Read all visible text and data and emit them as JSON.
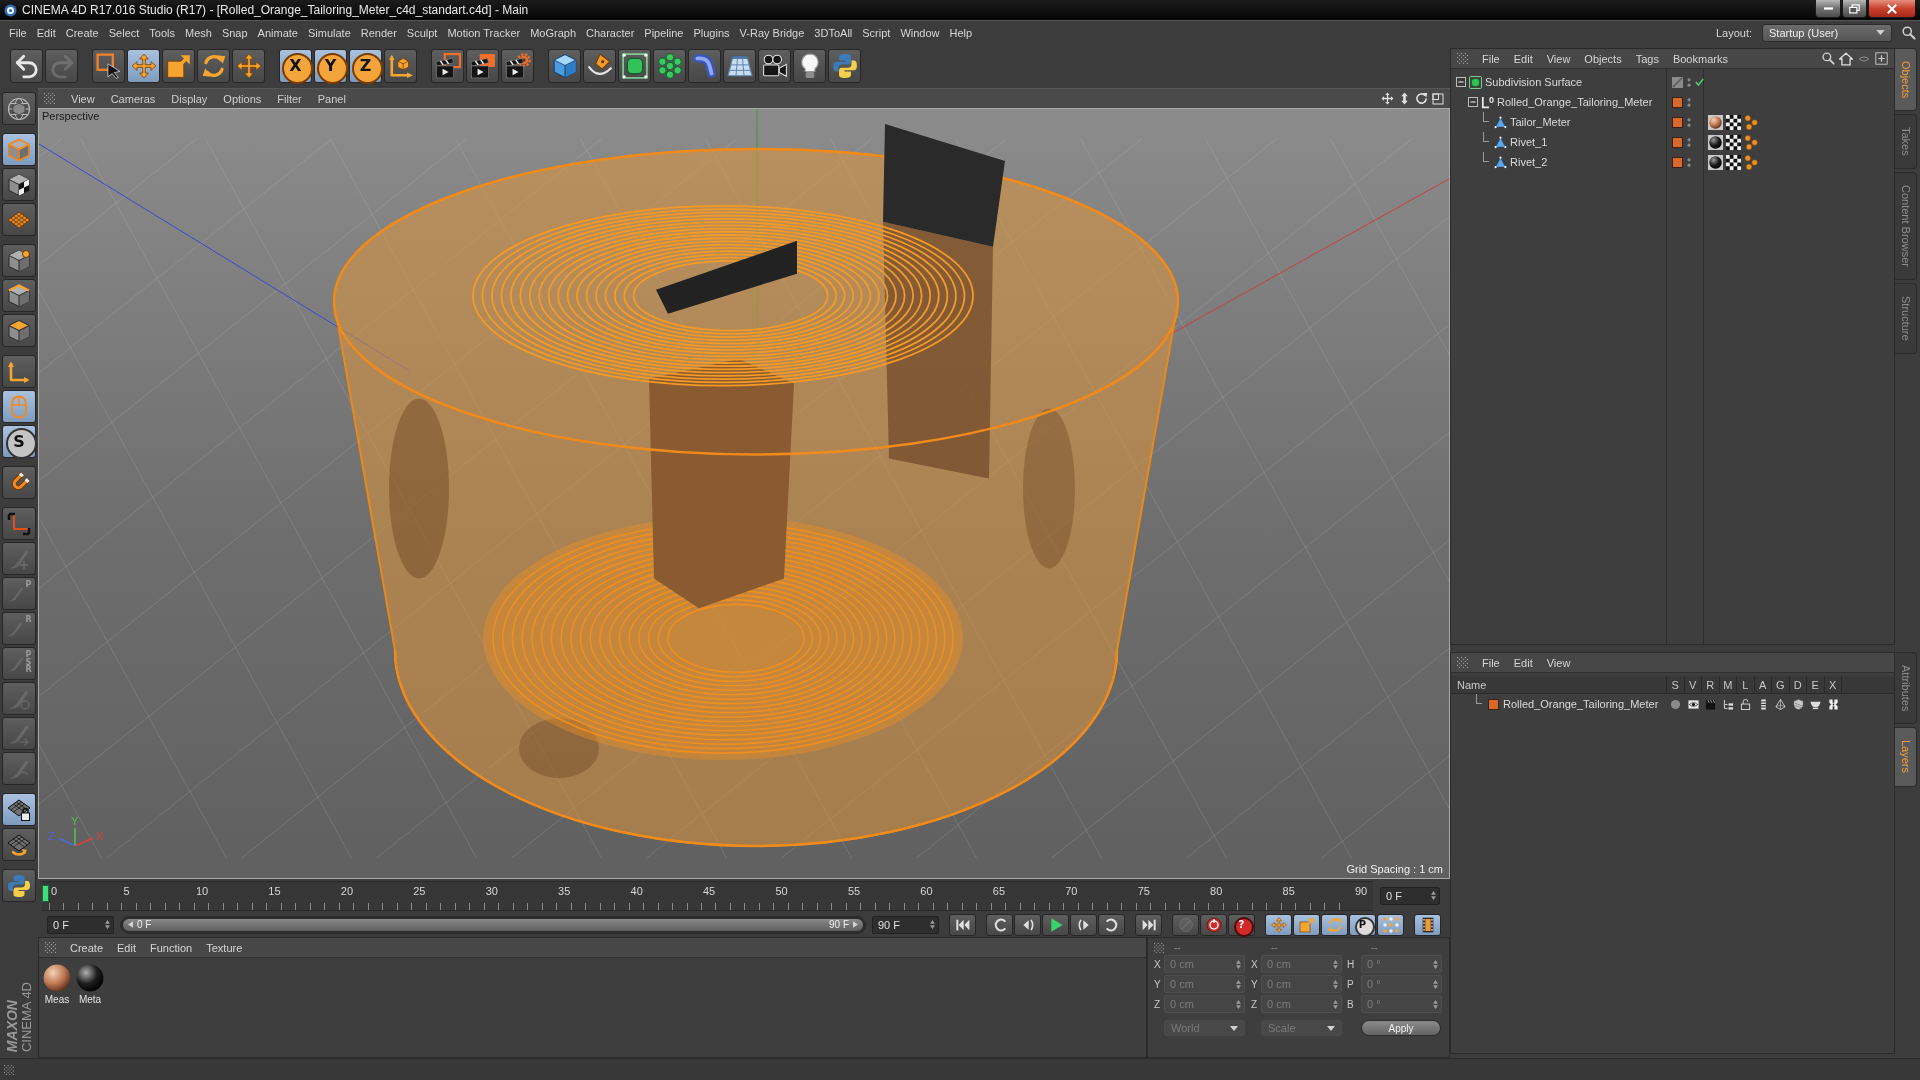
{
  "window": {
    "title": "CINEMA 4D R17.016 Studio (R17) - [Rolled_Orange_Tailoring_Meter_c4d_standart.c4d] - Main"
  },
  "menu_bar": {
    "items": [
      "File",
      "Edit",
      "Create",
      "Select",
      "Tools",
      "Mesh",
      "Snap",
      "Animate",
      "Simulate",
      "Render",
      "Sculpt",
      "Motion Tracker",
      "MoGraph",
      "Character",
      "Pipeline",
      "Plugins",
      "V-Ray Bridge",
      "3DToAll",
      "Script",
      "Window",
      "Help"
    ],
    "layout_label": "Layout:",
    "layout_value": "Startup (User)"
  },
  "toolbar": [
    [
      {
        "kind": "undo",
        "selected": false,
        "disabled": false
      },
      {
        "kind": "redo",
        "selected": false,
        "disabled": true
      }
    ],
    [
      {
        "kind": "live-select",
        "selected": false,
        "disabled": false
      },
      {
        "kind": "move",
        "selected": true,
        "disabled": false
      },
      {
        "kind": "scale",
        "selected": false,
        "disabled": false
      },
      {
        "kind": "rotate",
        "selected": false,
        "disabled": false
      },
      {
        "kind": "move",
        "selected": false,
        "disabled": false
      }
    ],
    [
      {
        "kind": "axis",
        "label": "X",
        "selected": true,
        "disabled": false
      },
      {
        "kind": "axis",
        "label": "Y",
        "selected": true,
        "disabled": false
      },
      {
        "kind": "axis",
        "label": "Z",
        "selected": true,
        "disabled": false
      },
      {
        "kind": "coord-system",
        "selected": false,
        "disabled": false
      }
    ],
    [
      {
        "kind": "render-view",
        "selected": false,
        "disabled": false
      },
      {
        "kind": "render-picture",
        "selected": false,
        "disabled": false
      },
      {
        "kind": "render-settings",
        "selected": false,
        "disabled": false
      }
    ],
    [
      {
        "kind": "cube",
        "selected": false,
        "disabled": false
      },
      {
        "kind": "pen",
        "selected": false,
        "disabled": false
      },
      {
        "kind": "subdivision",
        "selected": false,
        "disabled": false
      },
      {
        "kind": "cloner",
        "selected": false,
        "disabled": false
      },
      {
        "kind": "bend",
        "selected": false,
        "disabled": false
      },
      {
        "kind": "floor",
        "selected": false,
        "disabled": false
      },
      {
        "kind": "camera",
        "selected": false,
        "disabled": false
      },
      {
        "kind": "light",
        "selected": false,
        "disabled": false
      },
      {
        "kind": "python",
        "selected": false,
        "disabled": false
      }
    ]
  ],
  "left_toolbar": [
    [
      {
        "kind": "make-editable",
        "selected": false,
        "disabled": false
      }
    ],
    [
      {
        "kind": "model",
        "selected": true,
        "disabled": false
      },
      {
        "kind": "texture",
        "selected": false,
        "disabled": false
      },
      {
        "kind": "workplane",
        "selected": false,
        "disabled": false
      }
    ],
    [
      {
        "kind": "points",
        "selected": false,
        "disabled": false
      },
      {
        "kind": "edges",
        "selected": false,
        "disabled": false
      },
      {
        "kind": "polygons",
        "selected": false,
        "disabled": false
      }
    ],
    [
      {
        "kind": "axis-mode",
        "selected": false,
        "disabled": false
      },
      {
        "kind": "tweak",
        "selected": true,
        "disabled": false
      },
      {
        "kind": "snap",
        "label": "S",
        "selected": true,
        "disabled": false
      }
    ],
    [
      {
        "kind": "magnet",
        "selected": false,
        "disabled": false
      }
    ],
    [
      {
        "kind": "workplane-axis",
        "selected": false,
        "disabled": false
      },
      {
        "kind": "sculpt-move",
        "selected": false,
        "disabled": true
      },
      {
        "kind": "sculpt",
        "label": "P",
        "selected": false,
        "disabled": true
      },
      {
        "kind": "sculpt",
        "label": "R",
        "selected": false,
        "disabled": true
      },
      {
        "kind": "sculpt",
        "label": "PSR",
        "selected": false,
        "disabled": true
      },
      {
        "kind": "sculpt-circle",
        "selected": false,
        "disabled": true
      },
      {
        "kind": "sculpt-pull",
        "selected": false,
        "disabled": true
      },
      {
        "kind": "sculpt-smooth",
        "selected": false,
        "disabled": true
      }
    ],
    [
      {
        "kind": "grid-lock",
        "selected": true,
        "disabled": false
      },
      {
        "kind": "grid-rotate",
        "selected": false,
        "disabled": false
      }
    ],
    [
      {
        "kind": "python",
        "selected": false,
        "disabled": false
      }
    ]
  ],
  "logo": {
    "brand": "MAXON",
    "product": "CINEMA 4D"
  },
  "viewport": {
    "menu": [
      "View",
      "Cameras",
      "Display",
      "Options",
      "Filter",
      "Panel"
    ],
    "camera": "Perspective",
    "grid_spacing": "Grid Spacing : 1 cm",
    "gizmo": [
      "Z",
      "Y",
      "X"
    ]
  },
  "timeline": {
    "ticks": [
      "0",
      "5",
      "10",
      "15",
      "20",
      "25",
      "30",
      "35",
      "40",
      "45",
      "50",
      "55",
      "60",
      "65",
      "70",
      "75",
      "80",
      "85",
      "90"
    ],
    "playhead": {
      "level": 0
    },
    "frame_field": "0 F"
  },
  "playback": {
    "start_field": "0 F",
    "range": {
      "start": "0 F",
      "end": "90 F",
      "level": 1
    },
    "end_field": "90 F",
    "buttons": [
      [
        {
          "kind": "go-start",
          "selected": false,
          "disabled": false
        }
      ],
      [
        {
          "kind": "prev-key",
          "selected": false,
          "disabled": false
        },
        {
          "kind": "prev-frame",
          "selected": false,
          "disabled": false
        },
        {
          "kind": "play",
          "selected": false,
          "disabled": false
        },
        {
          "kind": "next-frame",
          "selected": false,
          "disabled": false
        },
        {
          "kind": "next-key",
          "selected": false,
          "disabled": false
        }
      ],
      [
        {
          "kind": "go-end",
          "selected": false,
          "disabled": false
        }
      ],
      [
        {
          "kind": "key-off",
          "selected": false,
          "disabled": true
        },
        {
          "kind": "record",
          "selected": false,
          "disabled": false
        },
        {
          "kind": "autokey",
          "label": "?",
          "selected": false,
          "disabled": false
        }
      ],
      [
        {
          "kind": "key-move",
          "selected": true,
          "disabled": false
        },
        {
          "kind": "key-scale",
          "selected": true,
          "disabled": false
        },
        {
          "kind": "key-rotate",
          "selected": true,
          "disabled": false
        },
        {
          "kind": "key-param",
          "label": "P",
          "selected": true,
          "disabled": false
        },
        {
          "kind": "key-points",
          "selected": true,
          "disabled": false
        }
      ],
      [
        {
          "kind": "film",
          "selected": true,
          "disabled": false
        }
      ]
    ]
  },
  "material_manager": {
    "menu": [
      "Create",
      "Edit",
      "Function",
      "Texture"
    ],
    "materials": [
      {
        "name": "Meas",
        "kind": "copper"
      },
      {
        "name": "Meta",
        "kind": "dark"
      }
    ]
  },
  "coordinates": {
    "disabled": true,
    "headers": [
      "--",
      "--",
      "--"
    ],
    "rows": [
      {
        "position_axis": "X",
        "position": "0 cm",
        "size_axis": "X",
        "size": "0 cm",
        "rotation_axis": "H",
        "rotation": "0 °"
      },
      {
        "position_axis": "Y",
        "position": "0 cm",
        "size_axis": "Y",
        "size": "0 cm",
        "rotation_axis": "P",
        "rotation": "0 °"
      },
      {
        "position_axis": "Z",
        "position": "0 cm",
        "size_axis": "Z",
        "size": "0 cm",
        "rotation_axis": "B",
        "rotation": "0 °"
      }
    ],
    "mode": "World",
    "size_mode": "Scale",
    "apply": "Apply"
  },
  "object_manager": {
    "menu": [
      "File",
      "Edit",
      "View",
      "Objects",
      "Tags",
      "Bookmarks"
    ],
    "objects": [
      {
        "name": "Subdivision Surface",
        "kind": "subdivision",
        "enabled": true,
        "expanded": true,
        "children": [
          {
            "name": "Rolled_Orange_Tailoring_Meter",
            "kind": "null",
            "icon_text": "0",
            "color": "#d8692a",
            "expanded": true,
            "children": [
              {
                "name": "Tailor_Meter",
                "kind": "polygon",
                "color": "#d8692a",
                "tags": [
                  {
                    "kind": "material-copper"
                  },
                  {
                    "kind": "checker"
                  },
                  {
                    "kind": "dots"
                  }
                ]
              },
              {
                "name": "Rivet_1",
                "kind": "polygon",
                "color": "#d8692a",
                "tags": [
                  {
                    "kind": "material-dark"
                  },
                  {
                    "kind": "checker"
                  },
                  {
                    "kind": "dots"
                  }
                ]
              },
              {
                "name": "Rivet_2",
                "kind": "polygon",
                "color": "#d8692a",
                "tags": [
                  {
                    "kind": "material-dark"
                  },
                  {
                    "kind": "checker"
                  },
                  {
                    "kind": "dots"
                  }
                ]
              }
            ]
          }
        ]
      }
    ]
  },
  "layer_manager": {
    "menu": [
      "File",
      "Edit",
      "View"
    ],
    "columns": [
      "Name",
      "S",
      "V",
      "R",
      "M",
      "L",
      "A",
      "G",
      "D",
      "E",
      "X"
    ],
    "layers": [
      {
        "name": "Rolled_Orange_Tailoring_Meter",
        "color": "#d8692a",
        "flags": [
          {
            "kind": "solo",
            "on": false
          },
          {
            "kind": "view",
            "on": true
          },
          {
            "kind": "render",
            "on": true
          },
          {
            "kind": "manager",
            "on": true
          },
          {
            "kind": "locked",
            "on": false
          },
          {
            "kind": "animation",
            "on": true
          },
          {
            "kind": "generators",
            "on": true
          },
          {
            "kind": "deformers",
            "on": true
          },
          {
            "kind": "expressions",
            "on": true
          },
          {
            "kind": "xref",
            "on": true
          }
        ]
      }
    ]
  },
  "side_tabs": {
    "upper": [
      {
        "label": "Objects",
        "selected": true
      },
      {
        "label": "Takes",
        "selected": false
      },
      {
        "label": "Content Browser",
        "selected": false
      },
      {
        "label": "Structure",
        "selected": false
      }
    ],
    "lower": [
      {
        "label": "Attributes",
        "selected": false
      },
      {
        "label": "Layers",
        "selected": true
      }
    ]
  }
}
